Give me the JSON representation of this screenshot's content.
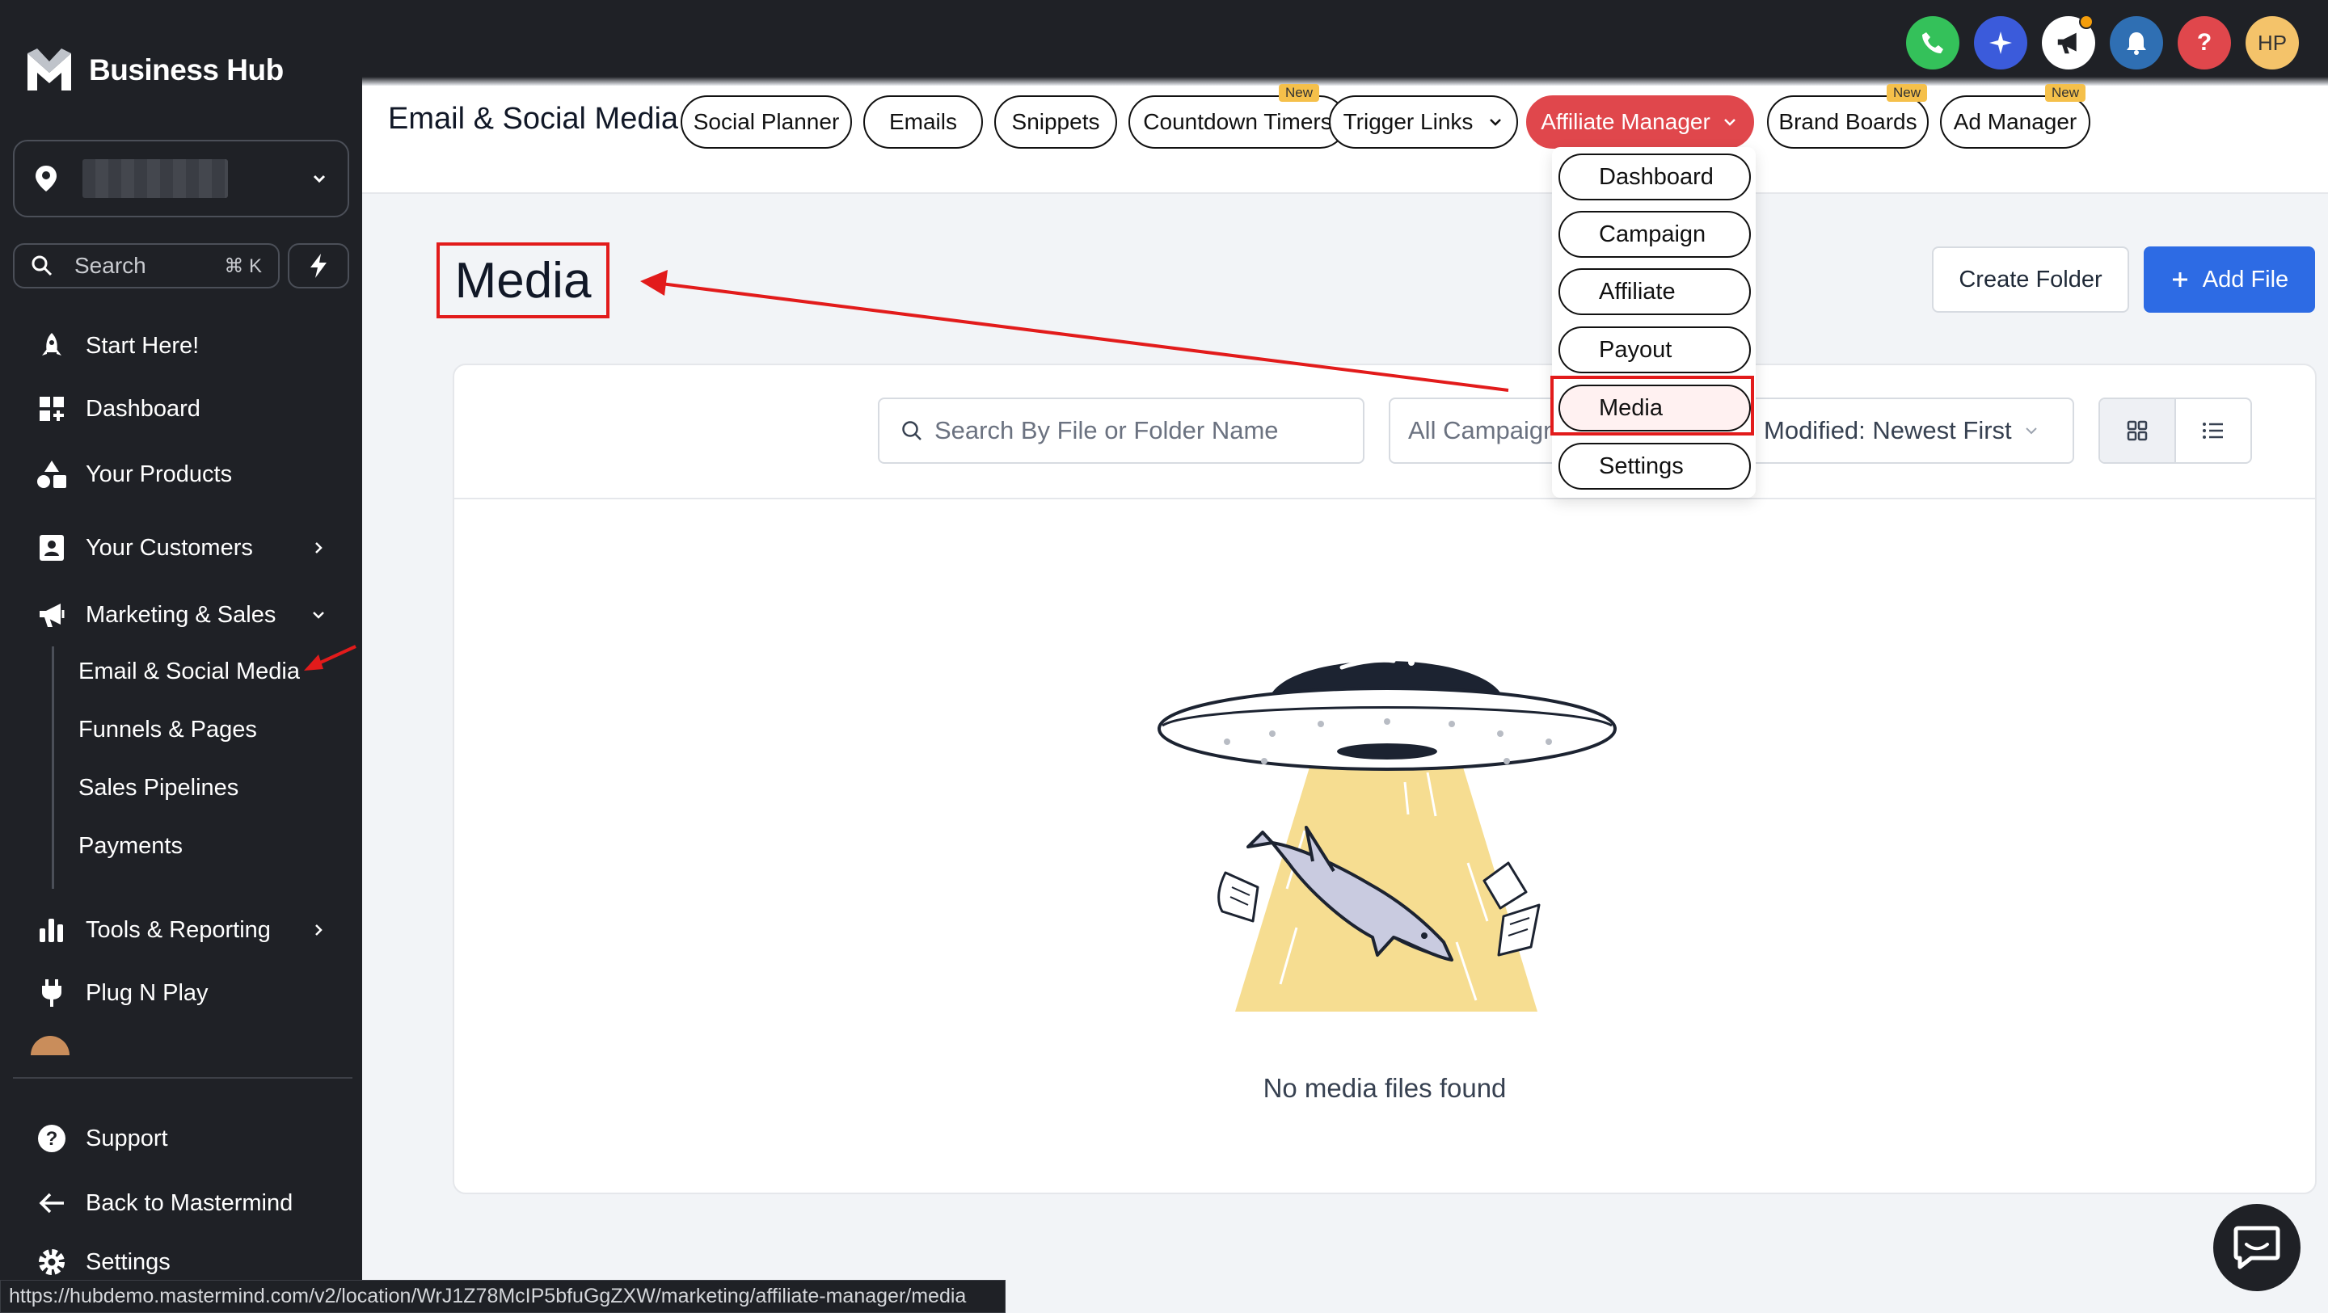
{
  "sidebar": {
    "brand": "Business Hub",
    "search_label": "Search",
    "search_shortcut": "⌘ K",
    "nav": [
      {
        "label": "Start Here!",
        "icon": "rocket-icon"
      },
      {
        "label": "Dashboard",
        "icon": "dashboard-icon"
      },
      {
        "label": "Your Products",
        "icon": "shapes-icon"
      },
      {
        "label": "Your Customers",
        "icon": "contact-card-icon"
      },
      {
        "label": "Marketing & Sales",
        "icon": "megaphone-icon"
      },
      {
        "label": "Tools & Reporting",
        "icon": "bar-chart-icon"
      },
      {
        "label": "Plug N Play",
        "icon": "plug-icon"
      }
    ],
    "sub_nav": [
      "Email & Social Media",
      "Funnels & Pages",
      "Sales Pipelines",
      "Payments"
    ],
    "bottom": [
      {
        "label": "Support",
        "icon": "help-circle-icon"
      },
      {
        "label": "Back to Mastermind",
        "icon": "arrow-left-icon"
      },
      {
        "label": "Settings",
        "icon": "gear-icon"
      }
    ]
  },
  "topbar": {
    "avatar_initials": "HP",
    "help_glyph": "?"
  },
  "subnav": {
    "title": "Email & Social Media",
    "tabs": [
      {
        "label": "Social Planner",
        "new": ""
      },
      {
        "label": "Emails",
        "new": ""
      },
      {
        "label": "Snippets",
        "new": ""
      },
      {
        "label": "Countdown Timers",
        "new": "New"
      },
      {
        "label": "Trigger Links",
        "new": ""
      },
      {
        "label": "Affiliate Manager",
        "new": ""
      },
      {
        "label": "Brand Boards",
        "new": "New"
      },
      {
        "label": "Ad Manager",
        "new": "New"
      }
    ]
  },
  "dropdown": {
    "items": [
      "Dashboard",
      "Campaign",
      "Affiliate",
      "Payout",
      "Media",
      "Settings"
    ],
    "selected": "Media"
  },
  "page": {
    "title": "Media",
    "create_folder": "Create Folder",
    "add_file": "Add File",
    "search_placeholder": "Search By File or Folder Name",
    "campaign_filter": "All Campaigns",
    "sort": "Modified: Newest First",
    "empty_message": "No media files found"
  },
  "statusbar": {
    "url": "https://hubdemo.mastermind.com/v2/location/WrJ1Z78McIP5bfuGgZXW/marketing/affiliate-manager/media"
  },
  "colors": {
    "sidebar_bg": "#1f2126",
    "active_tab": "#e0474c",
    "primary": "#2d6be4",
    "annotation_red": "#e21b1b",
    "new_badge": "#f5c04a"
  }
}
